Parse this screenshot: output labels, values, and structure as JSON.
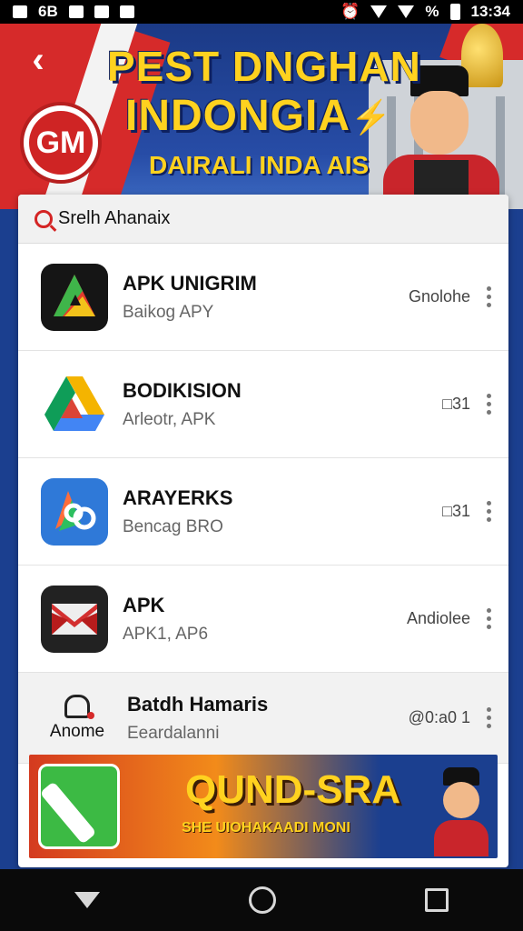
{
  "status_bar": {
    "left_text": "6B",
    "battery": "%",
    "time": "13:34"
  },
  "banner": {
    "title_line1": "PEST DNGHAN",
    "title_line2": "INDONGIA",
    "subtitle": "DAIRALI INDA AIS",
    "logo_text": "GM"
  },
  "search": {
    "value": "Srelh Ahanaix"
  },
  "apps": [
    {
      "name": "APK UNIGRIM",
      "subtitle": "Baikog APY",
      "status": "Gnolohe"
    },
    {
      "name": "BODIKISION",
      "subtitle": "Arleotr, APK",
      "status": "□31"
    },
    {
      "name": "ARAYERKS",
      "subtitle": "Bencag BRO",
      "status": "□31"
    },
    {
      "name": "APK",
      "subtitle": "APK1, AP6",
      "status": "Andiolee"
    }
  ],
  "highlight_row": {
    "icon_label": "Anome",
    "name": "Batdh Hamaris",
    "subtitle": "Eeardalanni",
    "status": "@0:a0 1"
  },
  "promo": {
    "title": "QUND-SRA",
    "subtitle": "SHE UIOHAKAADI MONI"
  },
  "colors": {
    "accent_yellow": "#ffd21f",
    "banner_blue": "#1b3a86",
    "flag_red": "#d62a2a"
  }
}
